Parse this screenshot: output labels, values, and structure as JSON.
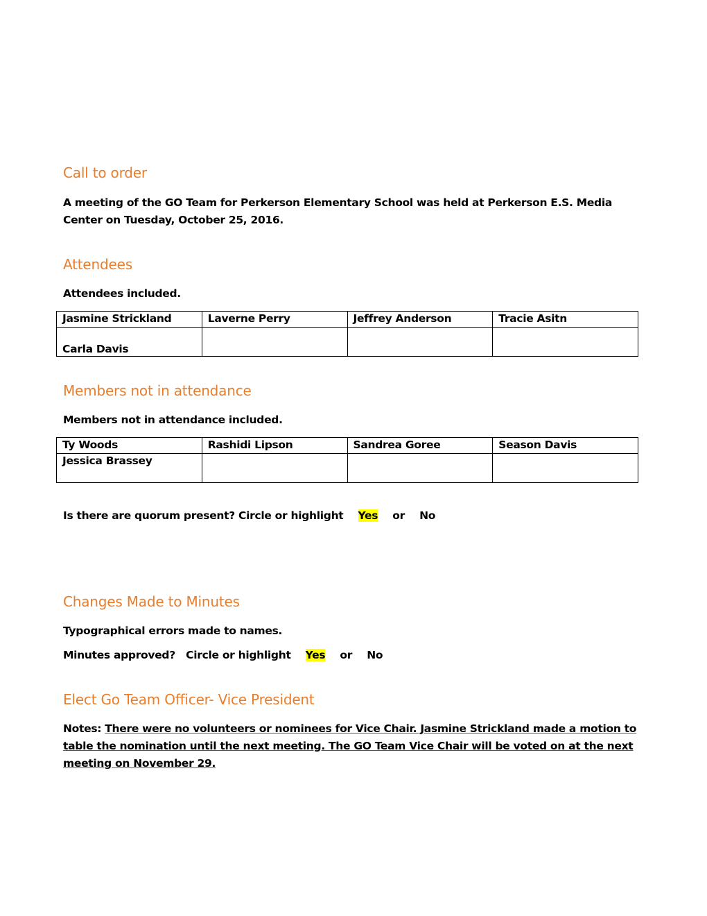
{
  "sections": {
    "call_to_order": {
      "heading": "Call to order",
      "body": "A meeting of the GO Team for Perkerson Elementary School was held at Perkerson E.S. Media Center on Tuesday, October 25, 2016."
    },
    "attendees": {
      "heading": "Attendees",
      "intro": "Attendees included.",
      "rows": [
        [
          "Jasmine Strickland",
          "Laverne Perry",
          "Jeffrey Anderson",
          "Tracie Asitn"
        ],
        [
          "Carla Davis",
          "",
          "",
          ""
        ]
      ]
    },
    "absent": {
      "heading": "Members not in attendance",
      "intro": "Members not in attendance included.",
      "rows": [
        [
          "Ty Woods",
          "Rashidi Lipson",
          "Sandrea Goree",
          "Season Davis"
        ],
        [
          "Jessica Brassey",
          "",
          "",
          ""
        ]
      ]
    },
    "quorum": {
      "question": "Is there are quorum present?  Circle or highlight",
      "yes": "Yes",
      "or": "or",
      "no": "No",
      "selected": "Yes"
    },
    "changes": {
      "heading": "Changes Made to Minutes",
      "body": "Typographical errors made to names.",
      "question": "Minutes approved?   Circle or highlight",
      "yes": "Yes",
      "or": "or",
      "no": "No",
      "selected": "Yes"
    },
    "elect": {
      "heading": "Elect Go Team Officer- Vice President",
      "notes_label": "Notes:",
      "notes": "There were no volunteers or nominees for Vice Chair.  Jasmine Strickland made a motion to table the nomination until the next meeting.  The GO Team Vice Chair will be voted on at the next meeting on November 29."
    }
  },
  "colors": {
    "heading": "#e87d2b",
    "highlight": "#ffff00"
  }
}
